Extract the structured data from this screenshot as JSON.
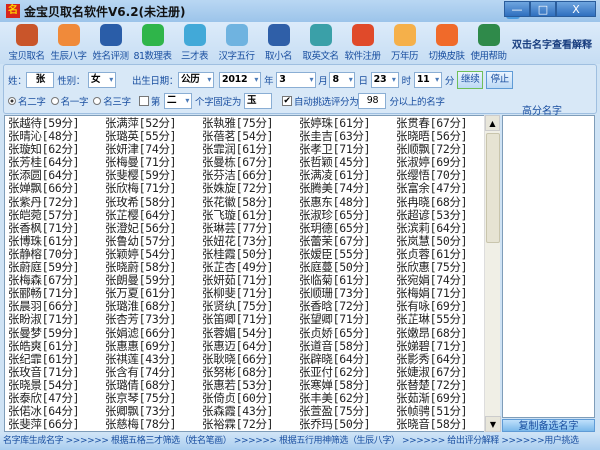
{
  "window": {
    "title": "金宝贝取名软件V6.2(未注册)",
    "icon": "app-logo-icon",
    "minimize": "—",
    "maximize": "□",
    "close": "X"
  },
  "toolbar": {
    "items": [
      {
        "label": "宝贝取名",
        "icon": "baby-family-icon",
        "color": "#c9552a"
      },
      {
        "label": "生辰八字",
        "icon": "heart-magnifier-icon",
        "color": "#f08a3a"
      },
      {
        "label": "姓名评测",
        "icon": "myspace-icon",
        "color": "#2a5da8"
      },
      {
        "label": "81数理表",
        "icon": "chat-bubble-icon",
        "color": "#2fb54a"
      },
      {
        "label": "三才表",
        "icon": "twitter-icon",
        "color": "#42a9d8"
      },
      {
        "label": "汉字五行",
        "icon": "users-icon",
        "color": "#6fb3e0"
      },
      {
        "label": "取小名",
        "icon": "car-icon",
        "color": "#2f5fa8"
      },
      {
        "label": "取英文名",
        "icon": "stumbleupon-icon",
        "color": "#3aa0a8"
      },
      {
        "label": "软件注册",
        "icon": "reddit-icon",
        "color": "#e04a2a"
      },
      {
        "label": "万年历",
        "icon": "flickr-icon",
        "color": "#f5b04a"
      },
      {
        "label": "切换皮肤",
        "icon": "heart-globe-icon",
        "color": "#f06a2a"
      },
      {
        "label": "使用帮助",
        "icon": "help-book-icon",
        "color": "#2f8a4a"
      }
    ],
    "hint": "双击名字查看解释"
  },
  "form": {
    "surname_label": "姓：",
    "surname": "张",
    "gender_label": "性别：",
    "gender": "女",
    "birth_label": "出生日期：",
    "calendar": "公历",
    "year": "2012",
    "year_label": "年",
    "month": "3",
    "month_label": "月",
    "day": "8",
    "day_label": "日",
    "hour": "23",
    "hour_label": "时",
    "minute": "11",
    "minute_label": "分",
    "continue": "继续",
    "stop": "停止",
    "radio_two": "名二字",
    "radio_one": "名一字",
    "radio_three": "名三字",
    "selected_radio": "名二字",
    "fix_prefix": "第",
    "fix_position": "二",
    "fix_mid": "个字固定为",
    "fix_char": "玉",
    "fix_checked": false,
    "auto_label": "自动挑选评分为",
    "auto_checked": true,
    "auto_score": "98",
    "auto_suffix": "分以上的名字",
    "high_score_label": "高分名字"
  },
  "names": [
    [
      "张越待[59分]",
      "张晴沁[48分]",
      "张璇知[62分]",
      "张芳桂[64分]",
      "张添圆[64分]",
      "张婵飘[66分]",
      "张紫丹[72分]",
      "张皑菀[57分]",
      "张香枫[71分]",
      "张博珠[61分]",
      "张静榕[70分]",
      "张蔚庭[59分]",
      "张梅森[67分]",
      "张郦畅[71分]",
      "张晨羽[66分]",
      "张盼淑[71分]",
      "张曼梦[59分]",
      "张皓爽[61分]",
      "张纪霏[61分]",
      "张玫音[71分]",
      "张晓景[54分]",
      "张泰欣[47分]",
      "张偌冰[64分]",
      "张斐萍[66分]",
      "张聿秀[59分]"
    ],
    [
      "张满萍[52分]",
      "张璐英[55分]",
      "张妍津[74分]",
      "张梅曼[71分]",
      "张斐樱[59分]",
      "张欣梅[71分]",
      "张玫希[58分]",
      "张芷樱[64分]",
      "张澄妃[56分]",
      "张鲁幼[57分]",
      "张颖婷[54分]",
      "张晓蔚[58分]",
      "张朗曼[59分]",
      "张万夏[61分]",
      "张璐淮[68分]",
      "张杏芳[73分]",
      "张娟滤[66分]",
      "张惠惠[69分]",
      "张祺莲[43分]",
      "张含有[74分]",
      "张璐倩[68分]",
      "张京琴[75分]",
      "张卿飘[73分]",
      "张慈梅[78分]",
      "张姝良[58分]"
    ],
    [
      "张執雅[75分]",
      "张蓓茗[54分]",
      "张霏润[61分]",
      "张曼栋[67分]",
      "张芬洁[66分]",
      "张姝旋[72分]",
      "张花徽[58分]",
      "张飞璇[61分]",
      "张琳芸[77分]",
      "张妞花[73分]",
      "张桂霞[50分]",
      "张芷杏[49分]",
      "张妍茹[71分]",
      "张柳斐[71分]",
      "张贤纨[75分]",
      "张笛卿[71分]",
      "张蓉媚[54分]",
      "张惠迈[64分]",
      "张耿晓[66分]",
      "张努彬[68分]",
      "张惠若[53分]",
      "张倚贞[60分]",
      "张森霞[43分]",
      "张裕霖[72分]",
      "张珂欣[47分]"
    ],
    [
      "张婷珠[61分]",
      "张圭吉[63分]",
      "张孝卫[71分]",
      "张哲颖[45分]",
      "张满凌[61分]",
      "张腾美[74分]",
      "张惠东[48分]",
      "张淑珍[65分]",
      "张玥德[65分]",
      "张蕾茉[67分]",
      "张嫒臣[55分]",
      "张庭蔓[50分]",
      "张临菊[61分]",
      "张顺珊[73分]",
      "张香晗[72分]",
      "张望卿[71分]",
      "张贞娇[65分]",
      "张道音[58分]",
      "张辟晓[64分]",
      "张亚付[62分]",
      "张寒婵[58分]",
      "张丰美[62分]",
      "张萱盈[75分]",
      "张乔玛[50分]",
      "张美慕[60分]"
    ],
    [
      "张贯春[67分]",
      "张晓晤[56分]",
      "张顺飘[72分]",
      "张淑婷[69分]",
      "张缨悟[70分]",
      "张富余[47分]",
      "张冉晓[68分]",
      "张超谚[53分]",
      "张滨莉[64分]",
      "张岚慧[50分]",
      "张贞蓉[61分]",
      "张欣惠[75分]",
      "张宛娟[74分]",
      "张梅娟[71分]",
      "张有咏[69分]",
      "张芷琳[55分]",
      "张嫩昂[68分]",
      "张娣碧[71分]",
      "张影秀[64分]",
      "张婕淑[67分]",
      "张替楚[72分]",
      "张茹渐[69分]",
      "张帧骋[51分]",
      "张晓音[58分]",
      "张撤汝[70分]"
    ]
  ],
  "copy_button": "复制备选名字",
  "status": "名字库生成名字 >>>>>> 根据五格三才筛选（姓名笔画） >>>>>> 根据五行用神筛选（生辰八字） >>>>>> 给出评分解释 >>>>>>用户挑选"
}
